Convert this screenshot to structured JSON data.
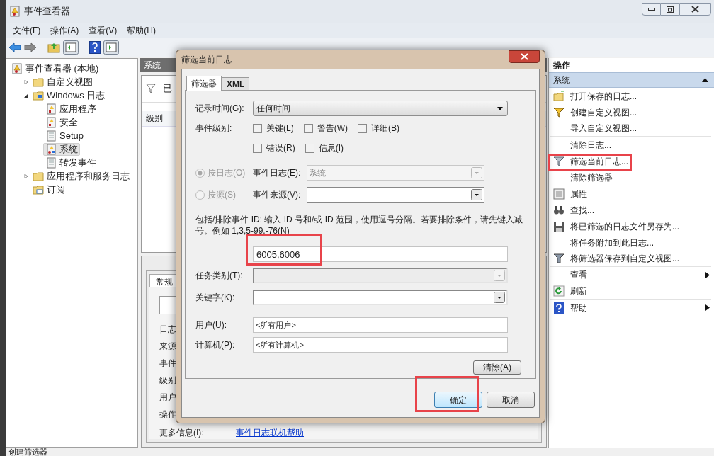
{
  "window": {
    "title": "事件查看器"
  },
  "menu": [
    "文件(F)",
    "操作(A)",
    "查看(V)",
    "帮助(H)"
  ],
  "tree": [
    {
      "label": "事件查看器 (本地)",
      "kind": "root",
      "selected": false,
      "children": [
        {
          "label": "自定义视图",
          "kind": "folder",
          "expanded": false,
          "selected": false
        },
        {
          "label": "Windows 日志",
          "kind": "folder-pc",
          "expanded": true,
          "selected": false,
          "children": [
            {
              "label": "应用程序",
              "kind": "log",
              "selected": false
            },
            {
              "label": "安全",
              "kind": "log",
              "selected": false
            },
            {
              "label": "Setup",
              "kind": "plain",
              "selected": false
            },
            {
              "label": "系统",
              "kind": "system",
              "selected": true
            },
            {
              "label": "转发事件",
              "kind": "plain",
              "selected": false
            }
          ]
        },
        {
          "label": "应用程序和服务日志",
          "kind": "folder",
          "expanded": false,
          "selected": false
        },
        {
          "label": "订阅",
          "kind": "subscription",
          "selected": false
        }
      ]
    }
  ],
  "middle": {
    "header": "系统",
    "filter_text": "已",
    "column": "级别",
    "detail_tab": "常规",
    "detail_labels": [
      "日志",
      "来源",
      "事件",
      "级别",
      "用户",
      "操作"
    ],
    "more_info_label": "更多信息(I):",
    "more_info_link": "事件日志联机帮助"
  },
  "dialog": {
    "title": "筛选当前日志",
    "tabs": [
      {
        "label": "筛选器",
        "selected": true
      },
      {
        "label": "XML",
        "selected": false
      }
    ],
    "logged": {
      "label": "记录时间(G):",
      "value": "任何时间"
    },
    "levels": {
      "label": "事件级别:",
      "rows": [
        [
          {
            "label": "关键(L)",
            "checked": false
          },
          {
            "label": "警告(W)",
            "checked": false
          },
          {
            "label": "详细(B)",
            "checked": false
          }
        ],
        [
          {
            "label": "错误(R)",
            "checked": false
          },
          {
            "label": "信息(I)",
            "checked": false
          }
        ]
      ]
    },
    "sources": [
      {
        "radio": "按日志(O)",
        "selected": true,
        "disabled": true,
        "label": "事件日志(E):",
        "value": "系统",
        "field_disabled": true
      },
      {
        "radio": "按源(S)",
        "selected": false,
        "disabled": true,
        "label": "事件来源(V):",
        "field_disabled": false
      }
    ],
    "event_ids": {
      "description": "包括/排除事件 ID: 输入 ID 号和/或 ID 范围，使用逗号分隔。若要排除条件，请先键入减号。例如 1,3,5-99,-76(N)",
      "value": "6005,6006"
    },
    "task_category": {
      "label": "任务类别(T):",
      "disabled": true
    },
    "keywords": {
      "label": "关键字(K):",
      "disabled": false
    },
    "user": {
      "label": "用户(U):",
      "value": "<所有用户>"
    },
    "computer": {
      "label": "计算机(P):",
      "value": "<所有计算机>"
    },
    "clear_button": "清除(A)",
    "buttons": [
      {
        "label": "确定",
        "default": true
      },
      {
        "label": "取消",
        "default": false
      }
    ]
  },
  "actions": {
    "title": "操作",
    "section": "系统",
    "expanded": true,
    "items": [
      {
        "label": "打开保存的日志...",
        "kind": "folder",
        "submenu": false,
        "separator_after": false
      },
      {
        "label": "创建自定义视图...",
        "kind": "funnel",
        "submenu": false,
        "separator_after": false
      },
      {
        "label": "导入自定义视图...",
        "kind": "plain",
        "submenu": false,
        "separator_after": true
      },
      {
        "label": "清除日志...",
        "kind": "plain",
        "submenu": false,
        "separator_after": false
      },
      {
        "label": "筛选当前日志...",
        "kind": "funnel-grey",
        "submenu": false,
        "separator_after": false
      },
      {
        "label": "清除筛选器",
        "kind": "plain",
        "submenu": false,
        "separator_after": false
      },
      {
        "label": "属性",
        "kind": "properties",
        "submenu": false,
        "separator_after": false
      },
      {
        "label": "查找...",
        "kind": "binoculars",
        "submenu": false,
        "separator_after": false
      },
      {
        "label": "将已筛选的日志文件另存为...",
        "kind": "save",
        "submenu": false,
        "separator_after": false
      },
      {
        "label": "将任务附加到此日志...",
        "kind": "plain",
        "submenu": false,
        "separator_after": false
      },
      {
        "label": "将筛选器保存到自定义视图...",
        "kind": "funnel-save",
        "submenu": false,
        "separator_after": true
      },
      {
        "label": "查看",
        "kind": "plain",
        "submenu": true,
        "separator_after": true
      },
      {
        "label": "刷新",
        "kind": "refresh",
        "submenu": false,
        "separator_after": true
      },
      {
        "label": "帮助",
        "kind": "help",
        "submenu": true,
        "separator_after": false
      }
    ]
  },
  "status_bar": "创建筛选器"
}
